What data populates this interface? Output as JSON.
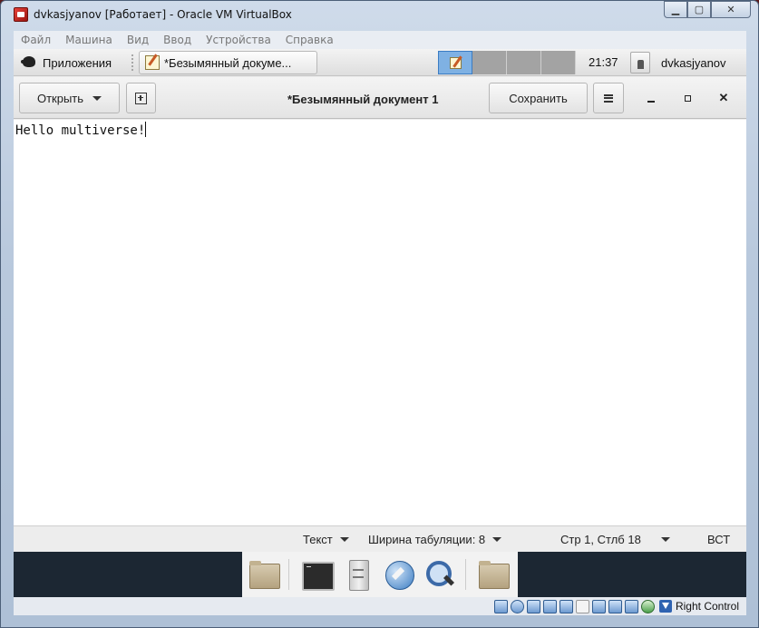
{
  "vbox": {
    "title": "dvkasjyanov [Работает] - Oracle VM VirtualBox",
    "menu": [
      "Файл",
      "Машина",
      "Вид",
      "Ввод",
      "Устройства",
      "Справка"
    ],
    "host_key_label": "Right Control"
  },
  "panel": {
    "apps_label": "Приложения",
    "task_label": "*Безымянный докуме...",
    "clock": "21:37",
    "user": "dvkasjyanov"
  },
  "gedit": {
    "open_label": "Открыть",
    "doc_title": "*Безымянный документ 1",
    "save_label": "Сохранить",
    "close_glyph": "✕",
    "content": "Hello multiverse!"
  },
  "statusbar": {
    "syntax": "Текст",
    "tab_width": "Ширина табуляции: 8",
    "position": "Стр 1, Стлб 18",
    "insert_mode": "ВСТ"
  },
  "dock": {
    "icons": [
      "folder-icon",
      "terminal-icon",
      "file-cabinet-icon",
      "web-browser-icon",
      "search-icon",
      "folder-icon"
    ]
  }
}
